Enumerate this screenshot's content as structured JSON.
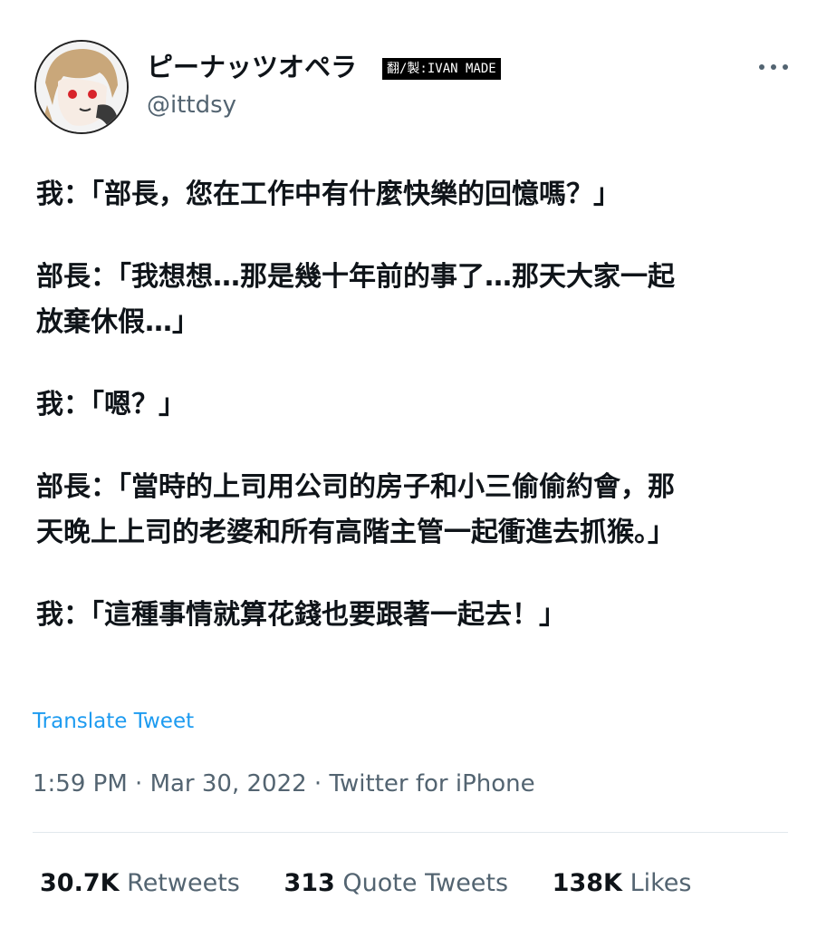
{
  "author": {
    "display_name": "ピーナッツオペラ",
    "handle": "@ittdsy",
    "avatar_icon": "anime-avatar-icon"
  },
  "watermark": "翻/製:IVAN MADE",
  "menu_icon": "more-options-icon",
  "tweet": {
    "paragraphs": [
      "我：「部長，您在工作中有什麼快樂的回憶嗎？」",
      "部長：「我想想…那是幾十年前的事了…那天大家一起\n放棄休假…」",
      "我：「嗯？」",
      "部長：「當時的上司用公司的房子和小三偷偷約會，那\n天晚上上司的老婆和所有高階主管一起衝進去抓猴。」",
      "我：「這種事情就算花錢也要跟著一起去！」"
    ],
    "translate_label": "Translate Tweet",
    "time": "1:59 PM",
    "date": "Mar 30, 2022",
    "source": "Twitter for iPhone",
    "separator": " · "
  },
  "stats": {
    "retweets_count": "30.7K",
    "retweets_label": "Retweets",
    "quotes_count": "313",
    "quotes_label": "Quote Tweets",
    "likes_count": "138K",
    "likes_label": "Likes"
  },
  "colors": {
    "link": "#1d9bf0",
    "muted": "#536471",
    "text": "#0f1419"
  }
}
